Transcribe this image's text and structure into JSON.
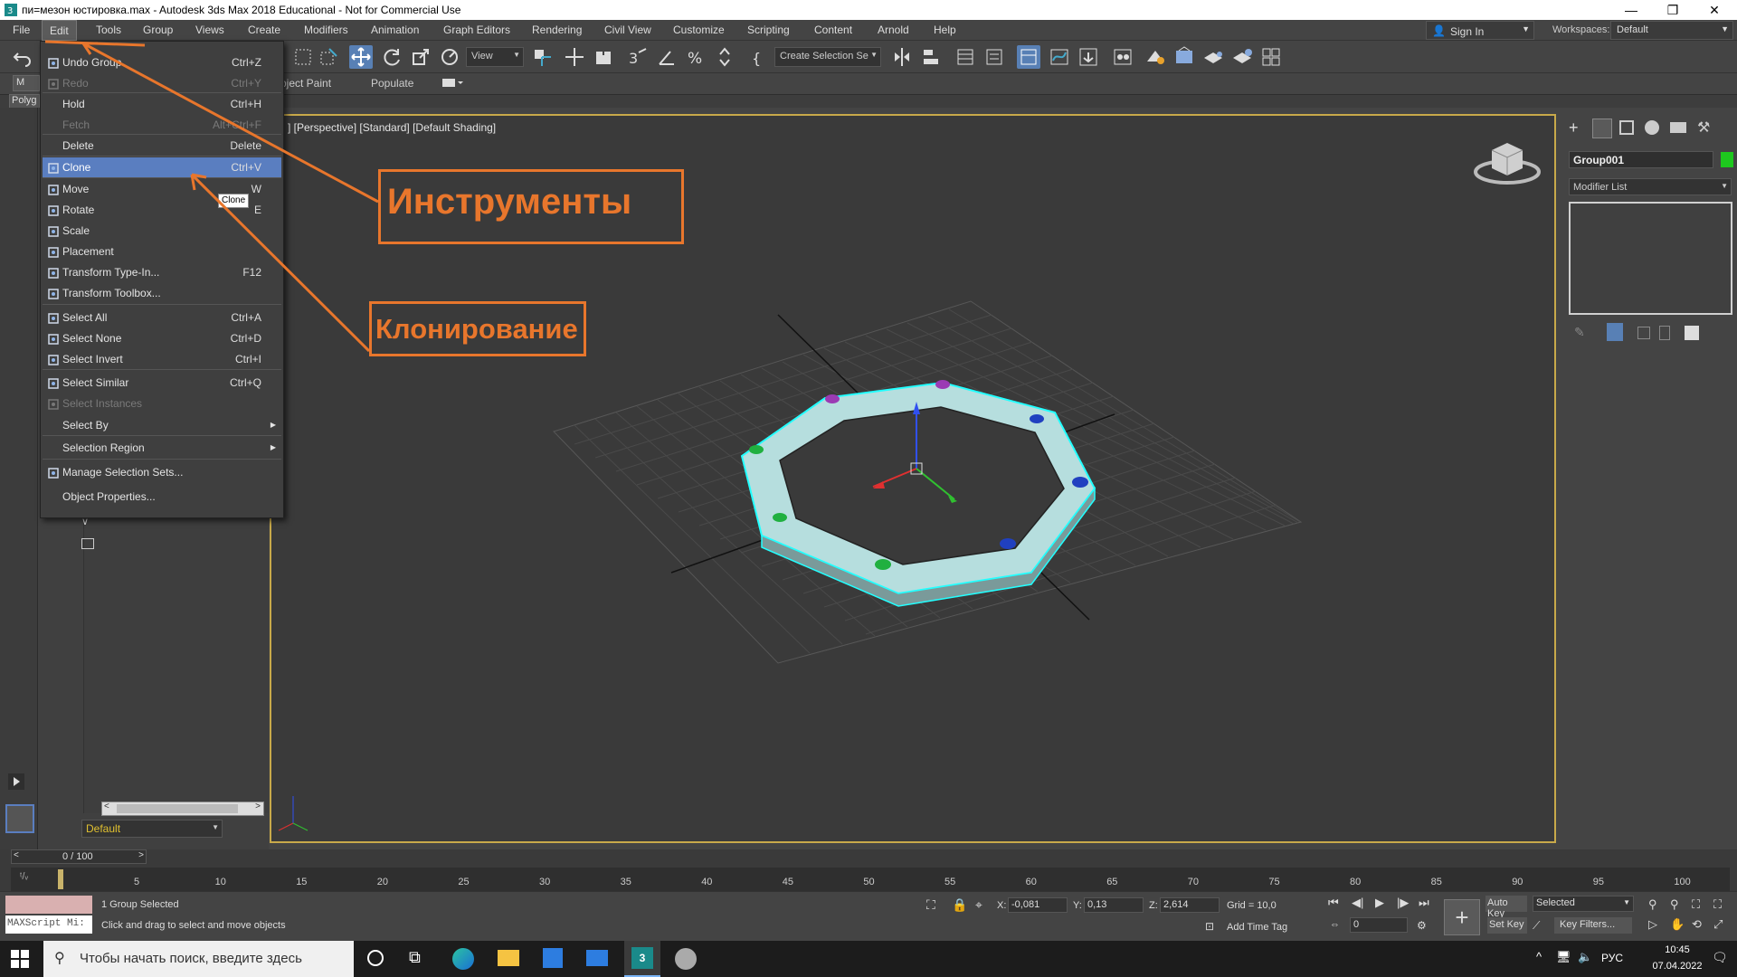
{
  "window": {
    "title": "пи=мезон юстировка.max - Autodesk 3ds Max 2018 Educational - Not for Commercial Use",
    "minimize": "—",
    "restore": "❐",
    "close": "✕"
  },
  "menubar": {
    "items": [
      "File",
      "Edit",
      "Tools",
      "Group",
      "Views",
      "Create",
      "Modifiers",
      "Animation",
      "Graph Editors",
      "Rendering",
      "Civil View",
      "Customize",
      "Scripting",
      "Content",
      "Arnold",
      "Help"
    ],
    "sign_in": "Sign In",
    "workspaces_label": "Workspaces:",
    "workspace_value": "Default"
  },
  "toolbar": {
    "view_dropdown": "View",
    "selection_set": "Create Selection Se"
  },
  "ribbon": {
    "tab_object_paint": "bject Paint",
    "tab_populate": "Populate",
    "left_label": "Polyg",
    "left_label2": "M"
  },
  "edit_menu": {
    "items": [
      {
        "label": "Undo Group",
        "shortcut": "Ctrl+Z",
        "disabled": false,
        "icon": "undo-icon"
      },
      {
        "label": "Redo",
        "shortcut": "Ctrl+Y",
        "disabled": true,
        "icon": "redo-icon"
      },
      {
        "label": "Hold",
        "shortcut": "Ctrl+H",
        "disabled": false
      },
      {
        "label": "Fetch",
        "shortcut": "Alt+Ctrl+F",
        "disabled": true
      },
      {
        "label": "Delete",
        "shortcut": "Delete",
        "disabled": false
      },
      {
        "label": "Clone",
        "shortcut": "Ctrl+V",
        "disabled": false,
        "highlight": true,
        "icon": "clone-icon"
      },
      {
        "label": "Move",
        "shortcut": "W",
        "disabled": false,
        "icon": "move-icon"
      },
      {
        "label": "Rotate",
        "shortcut": "E",
        "disabled": false,
        "icon": "rotate-icon"
      },
      {
        "label": "Scale",
        "shortcut": "",
        "disabled": false,
        "icon": "scale-icon"
      },
      {
        "label": "Placement",
        "shortcut": "",
        "disabled": false,
        "icon": "placement-icon"
      },
      {
        "label": "Transform Type-In...",
        "shortcut": "F12",
        "disabled": false,
        "icon": "transform-typein-icon"
      },
      {
        "label": "Transform Toolbox...",
        "shortcut": "",
        "disabled": false,
        "icon": "transform-toolbox-icon"
      },
      {
        "label": "Select All",
        "shortcut": "Ctrl+A",
        "disabled": false,
        "icon": "select-all-icon"
      },
      {
        "label": "Select None",
        "shortcut": "Ctrl+D",
        "disabled": false,
        "icon": "select-none-icon"
      },
      {
        "label": "Select Invert",
        "shortcut": "Ctrl+I",
        "disabled": false,
        "icon": "select-invert-icon"
      },
      {
        "label": "Select Similar",
        "shortcut": "Ctrl+Q",
        "disabled": false,
        "icon": "select-similar-icon"
      },
      {
        "label": "Select Instances",
        "shortcut": "",
        "disabled": true,
        "icon": "select-instances-icon"
      },
      {
        "label": "Select By",
        "shortcut": "",
        "disabled": false,
        "submenu": true
      },
      {
        "label": "Selection Region",
        "shortcut": "",
        "disabled": false,
        "submenu": true
      },
      {
        "label": "Manage Selection Sets...",
        "shortcut": "",
        "disabled": false,
        "icon": "selection-sets-icon"
      },
      {
        "label": "Object Properties...",
        "shortcut": "",
        "disabled": false
      }
    ],
    "tooltip": "Clone"
  },
  "callouts": {
    "tools": "Инструменты",
    "clone": "Клонирование",
    "accent": "#e8762c"
  },
  "viewport": {
    "label": "[+] [Perspective] [Standard] [Default Shading]",
    "label_visible": "] [Perspective] [Standard] [Default Shading]",
    "border_color": "#c8a94a"
  },
  "command_panel": {
    "object_name": "Group001",
    "object_color": "#1ec81e",
    "modifier_list": "Modifier List"
  },
  "scene_panel": {
    "layer_default": "Default"
  },
  "timeline": {
    "frame_counter": "0 / 100",
    "ticks": [
      "5",
      "10",
      "15",
      "20",
      "25",
      "30",
      "35",
      "40",
      "45",
      "50",
      "55",
      "60",
      "65",
      "70",
      "75",
      "80",
      "85",
      "90",
      "95",
      "100"
    ]
  },
  "status": {
    "selection": "1 Group Selected",
    "hint": "Click and drag to select and move objects",
    "maxscript": "MAXScript Mi:",
    "x_label": "X:",
    "x_value": "-0,081",
    "y_label": "Y:",
    "y_value": "0,13",
    "z_label": "Z:",
    "z_value": "2,614",
    "grid": "Grid = 10,0",
    "add_time_tag": "Add Time Tag",
    "auto_key": "Auto Key",
    "set_key": "Set Key",
    "selected": "Selected",
    "key_filters": "Key Filters...",
    "frame_value": "0"
  },
  "taskbar": {
    "search_placeholder": "Чтобы начать поиск, введите здесь",
    "lang": "РУС",
    "time": "10:45",
    "date": "07.04.2022"
  }
}
